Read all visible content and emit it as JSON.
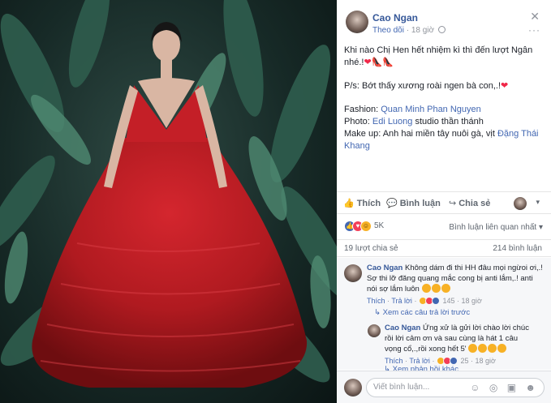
{
  "header": {
    "author": "Cao Ngan",
    "follow": "Theo dõi",
    "dot": "·",
    "time": "18 giờ",
    "close_icon": "close-icon",
    "more": "···"
  },
  "post": {
    "line1": "Khi nào Chị Hen hết nhiệm kì thì đến lượt Ngân nhé.!",
    "line1_emoji": "❤👠👠",
    "ps": "P/s: Bớt thấy xương roài ngen bà con,.!",
    "ps_emoji": "❤",
    "fashion_label": "Fashion: ",
    "fashion_link": "Quan Minh Phan Nguyen",
    "photo_label": "Photo: ",
    "photo_link": "Edi Luong",
    "photo_rest": " studio thần thánh",
    "makeup_label": "Make up: Anh hai miền tây nuôi gà, vịt ",
    "makeup_link": "Đặng Thái Khang"
  },
  "actions": {
    "like": "Thích",
    "comment": "Bình luận",
    "share": "Chia sẻ",
    "caret": "▾"
  },
  "reactions": {
    "count": "5K",
    "relevant": "Bình luận liên quan nhất ▾",
    "shares": "19 lượt chia sẻ",
    "comments": "214 bình luận",
    "colors": {
      "like": "#4267b2",
      "love": "#f33e58",
      "haha": "#f7b125"
    }
  },
  "comments": [
    {
      "author": "Cao Ngan",
      "text": "Không dám đi thi HH đâu mọi ngừoi ơi,.! Sợ thi lỡ đăng quang mắc cong bị anti lắm,.! anti nói sợ lắm luôn",
      "like": "Thích",
      "reply": "Trả lời",
      "count": "145",
      "time": "18 giờ"
    },
    {
      "see_more": "Xem các câu trả lời trước"
    },
    {
      "author": "Cao Ngan",
      "text": "Ứng xử là gửi lời chào lời chúc rồi lời cảm ơn và sau cùng là hát 1 câu vọng cổ,.,rồi xong hết 5'",
      "like": "Thích",
      "reply": "Trả lời",
      "count": "25",
      "time": "18 giờ"
    },
    {
      "see_more": "Xem phản hồi khác"
    }
  ],
  "composer": {
    "placeholder": "Viết bình luận...",
    "icons": "☺ ◎ ▣ ☻"
  }
}
